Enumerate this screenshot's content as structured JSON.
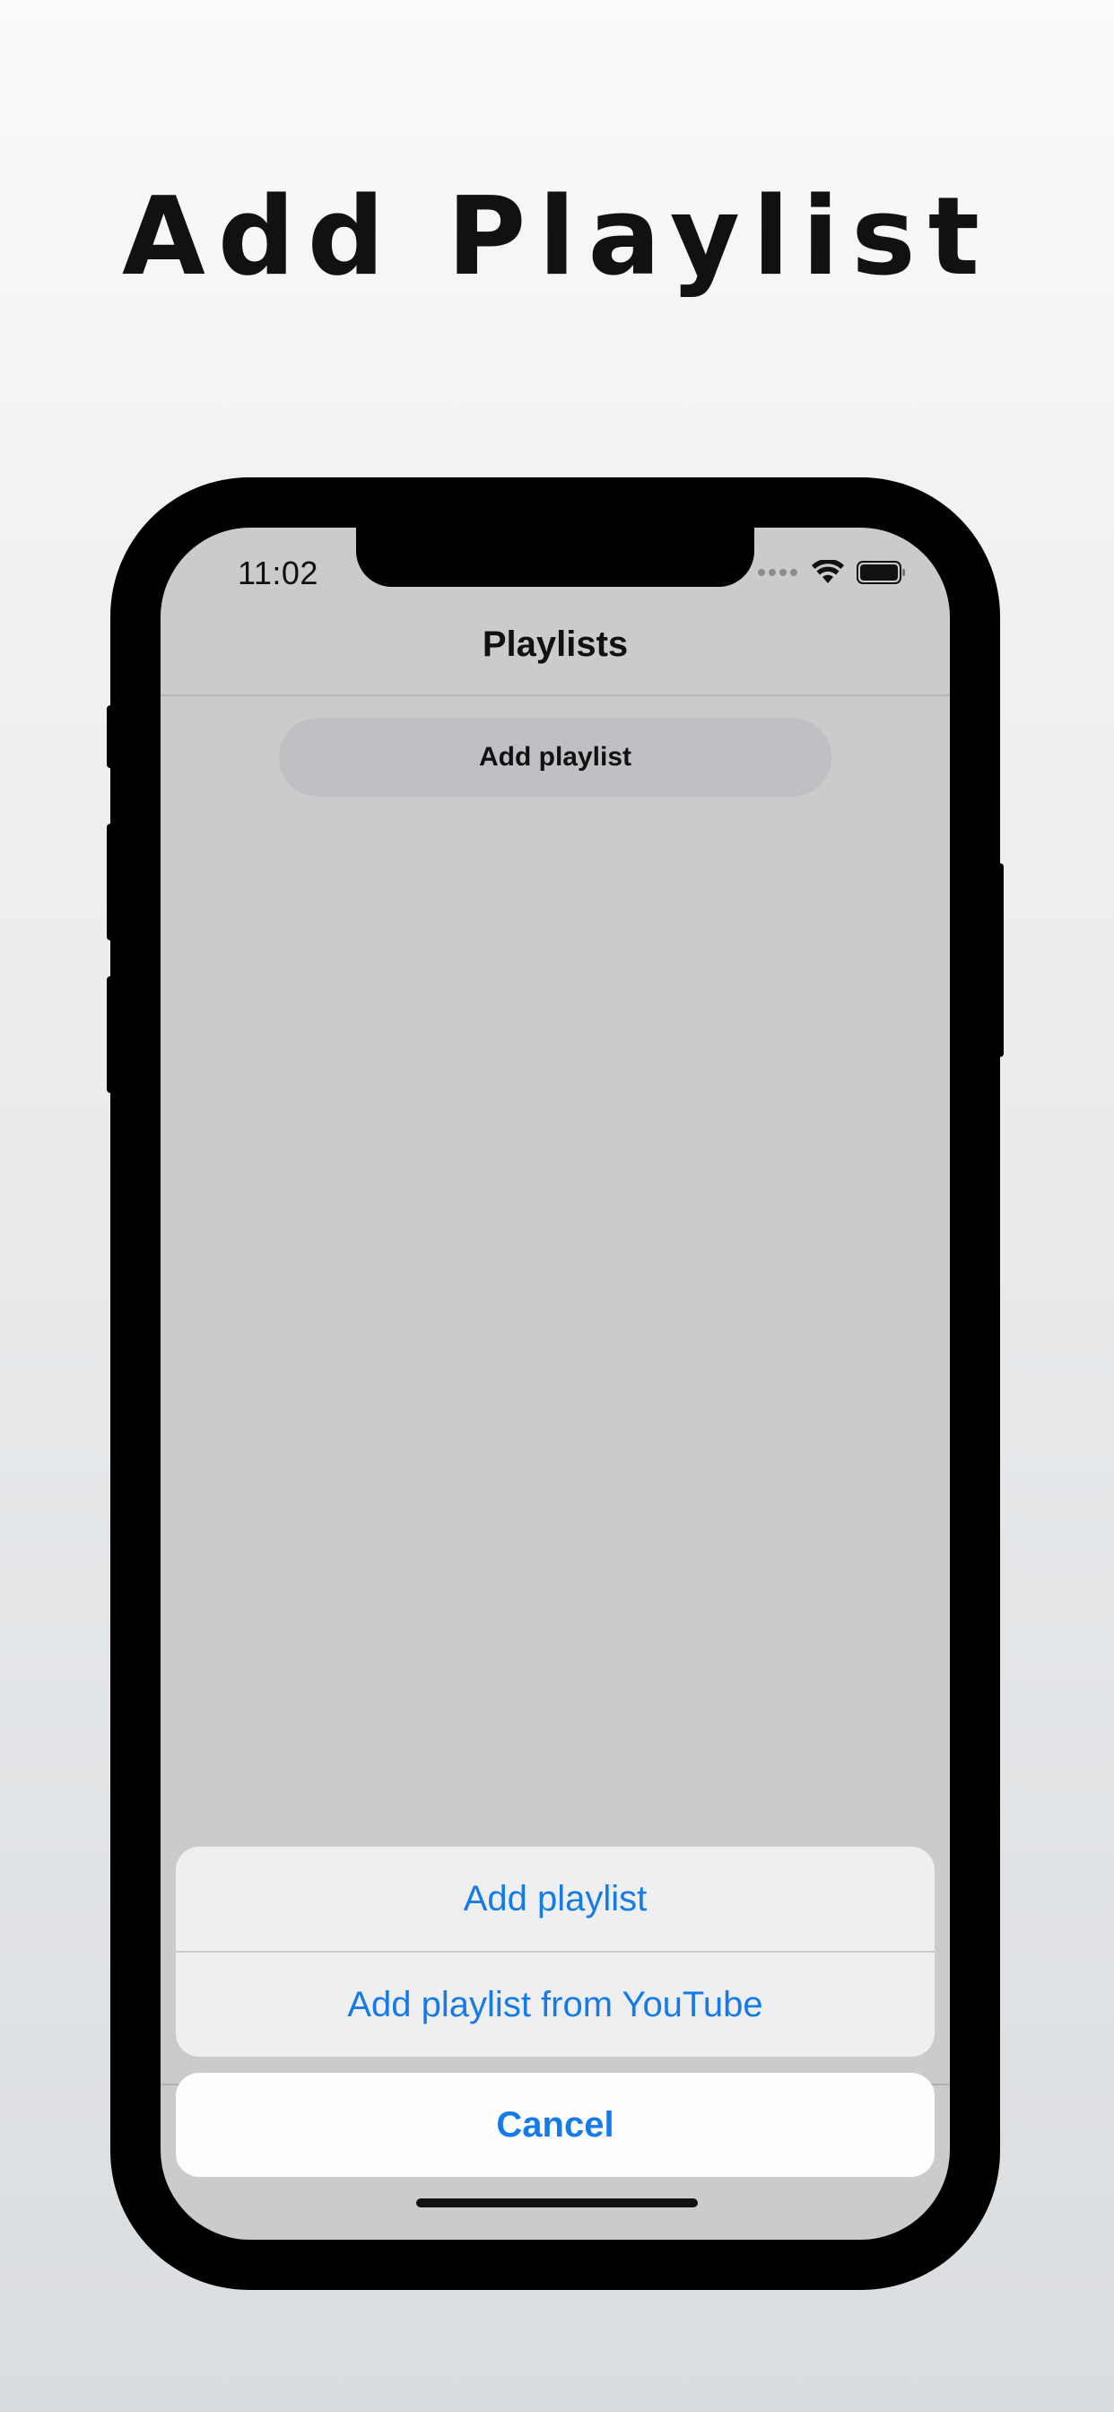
{
  "headline": "Add Playlist",
  "status_bar": {
    "time": "11:02",
    "icons": [
      "signal-dots-icon",
      "wifi-icon",
      "battery-icon"
    ]
  },
  "nav": {
    "title": "Playlists"
  },
  "main": {
    "add_button_label": "Add playlist"
  },
  "action_sheet": {
    "items": [
      {
        "label": "Add playlist"
      },
      {
        "label": "Add playlist from YouTube"
      }
    ],
    "cancel_label": "Cancel"
  },
  "colors": {
    "accent": "#157be8",
    "screen_dim": "#cbcbcb",
    "sheet_bg": "#efefef",
    "phone_frame": "#000000"
  }
}
